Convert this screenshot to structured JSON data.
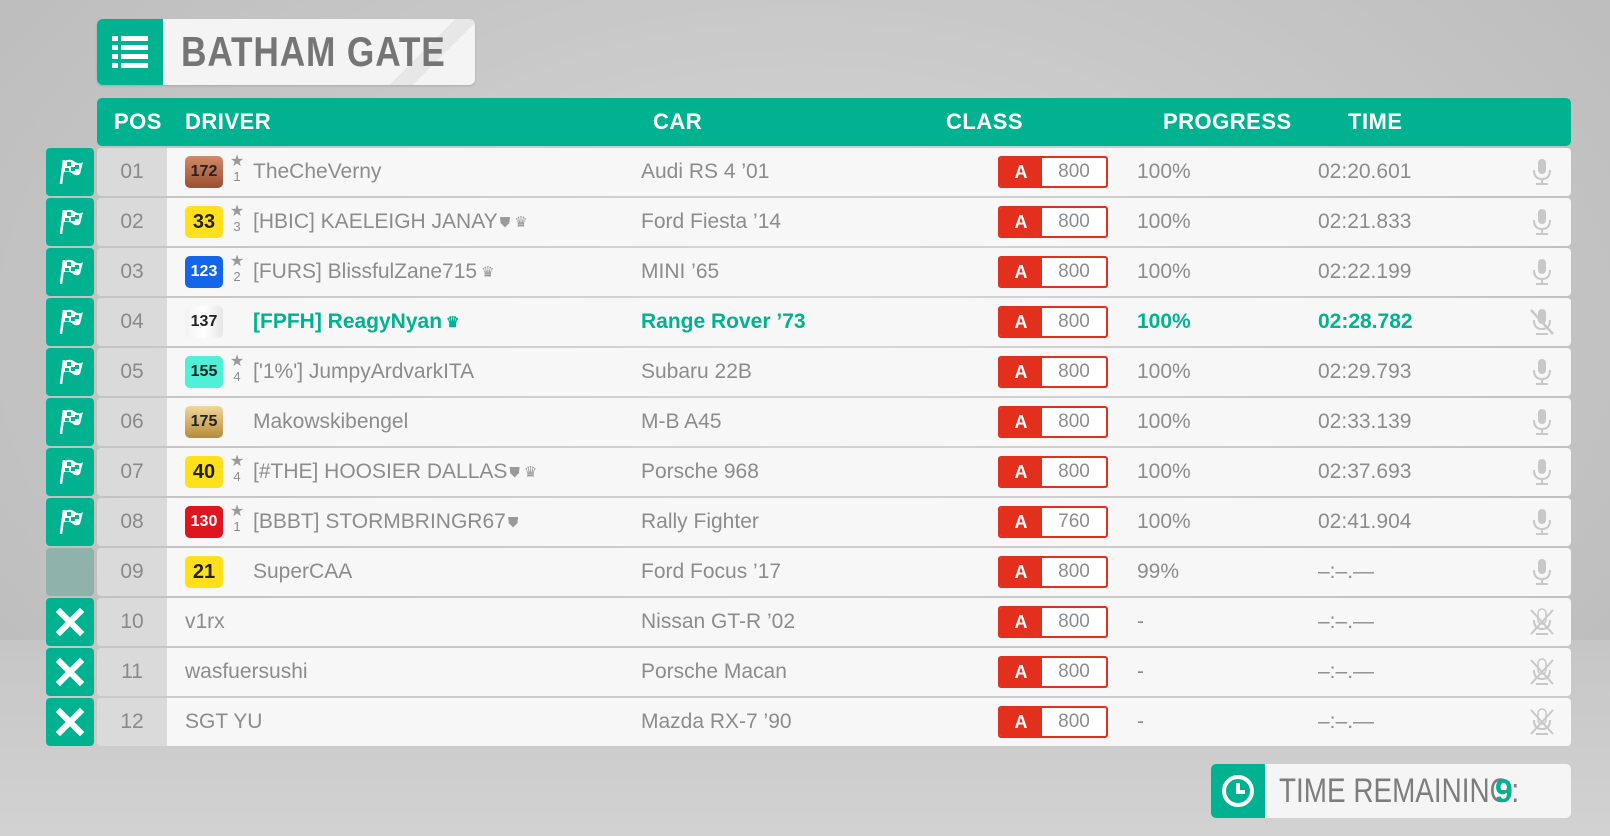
{
  "title": "BATHAM GATE",
  "header": {
    "pos": "POS",
    "driver": "DRIVER",
    "car": "CAR",
    "class": "CLASS",
    "progress": "PROGRESS",
    "time": "TIME"
  },
  "colors": {
    "accent": "#00b290",
    "class_red": "#e3301e"
  },
  "rows": [
    {
      "status": "finish-flag",
      "pos": "01",
      "level": "172",
      "level_style": "copper",
      "stars": "1",
      "driver": "TheCheVerny",
      "crown": false,
      "shield": false,
      "car": "Audi RS 4 ’01",
      "class": "A",
      "pi": "800",
      "progress": "100%",
      "time": "02:20.601",
      "mic": "mic-icon",
      "me": false
    },
    {
      "status": "finish-flag",
      "pos": "02",
      "level": "33",
      "level_style": "yellow",
      "stars": "3",
      "driver": "[HBIC]  KAELEIGH JANAY",
      "crown": true,
      "shield": true,
      "car": "Ford Fiesta ’14",
      "class": "A",
      "pi": "800",
      "progress": "100%",
      "time": "02:21.833",
      "mic": "mic-icon",
      "me": false
    },
    {
      "status": "finish-flag",
      "pos": "03",
      "level": "123",
      "level_style": "blue",
      "stars": "2",
      "driver": "[FURS]  BlissfulZane715",
      "crown": true,
      "shield": false,
      "car": "MINI ’65",
      "class": "A",
      "pi": "800",
      "progress": "100%",
      "time": "02:22.199",
      "mic": "mic-icon",
      "me": false
    },
    {
      "status": "finish-flag",
      "pos": "04",
      "level": "137",
      "level_style": "white",
      "stars": "",
      "driver": "[FPFH]  ReagyNyan",
      "crown": true,
      "shield": false,
      "car": "Range Rover ’73",
      "class": "A",
      "pi": "800",
      "progress": "100%",
      "time": "02:28.782",
      "mic": "mic-muted-icon",
      "me": true
    },
    {
      "status": "finish-flag",
      "pos": "05",
      "level": "155",
      "level_style": "cyan",
      "stars": "4",
      "driver": "['1%']  JumpyArdvarkITA",
      "crown": false,
      "shield": false,
      "car": "Subaru 22B",
      "class": "A",
      "pi": "800",
      "progress": "100%",
      "time": "02:29.793",
      "mic": "mic-icon",
      "me": false
    },
    {
      "status": "finish-flag",
      "pos": "06",
      "level": "175",
      "level_style": "gold",
      "stars": "",
      "driver": "Makowskibengel",
      "crown": false,
      "shield": false,
      "car": "M-B A45",
      "class": "A",
      "pi": "800",
      "progress": "100%",
      "time": "02:33.139",
      "mic": "mic-icon",
      "me": false
    },
    {
      "status": "finish-flag",
      "pos": "07",
      "level": "40",
      "level_style": "yellow",
      "stars": "4",
      "driver": "[#THE]  HOOSIER DALLAS",
      "crown": true,
      "shield": true,
      "car": "Porsche 968",
      "class": "A",
      "pi": "800",
      "progress": "100%",
      "time": "02:37.693",
      "mic": "mic-icon",
      "me": false
    },
    {
      "status": "finish-flag",
      "pos": "08",
      "level": "130",
      "level_style": "red",
      "stars": "1",
      "driver": "[BBBT]  STORMBRINGR67",
      "crown": false,
      "shield": true,
      "car": "Rally Fighter",
      "class": "A",
      "pi": "760",
      "progress": "100%",
      "time": "02:41.904",
      "mic": "mic-icon",
      "me": false
    },
    {
      "status": "empty",
      "pos": "09",
      "level": "21",
      "level_style": "yellow",
      "stars": "",
      "driver": "SuperCAA",
      "crown": false,
      "shield": false,
      "car": "Ford Focus ’17",
      "class": "A",
      "pi": "800",
      "progress": "99%",
      "time": "–:–.—",
      "mic": "mic-icon",
      "me": false
    },
    {
      "status": "dnf-x",
      "pos": "10",
      "level": "",
      "level_style": "",
      "stars": "",
      "driver": "v1rx",
      "crown": false,
      "shield": false,
      "car": "Nissan GT-R ’02",
      "class": "A",
      "pi": "800",
      "progress": "-",
      "time": "–:–.—",
      "mic": "mic-disabled-icon",
      "me": false
    },
    {
      "status": "dnf-x",
      "pos": "11",
      "level": "",
      "level_style": "",
      "stars": "",
      "driver": "wasfuersushi",
      "crown": false,
      "shield": false,
      "car": "Porsche Macan",
      "class": "A",
      "pi": "800",
      "progress": "-",
      "time": "–:–.—",
      "mic": "mic-disabled-icon",
      "me": false
    },
    {
      "status": "dnf-x",
      "pos": "12",
      "level": "",
      "level_style": "",
      "stars": "",
      "driver": "SGT YU",
      "crown": false,
      "shield": false,
      "car": "Mazda RX-7 ’90",
      "class": "A",
      "pi": "800",
      "progress": "-",
      "time": "–:–.—",
      "mic": "mic-disabled-icon",
      "me": false
    }
  ],
  "time_remaining": {
    "label": "TIME REMAINING:",
    "value": "9"
  }
}
